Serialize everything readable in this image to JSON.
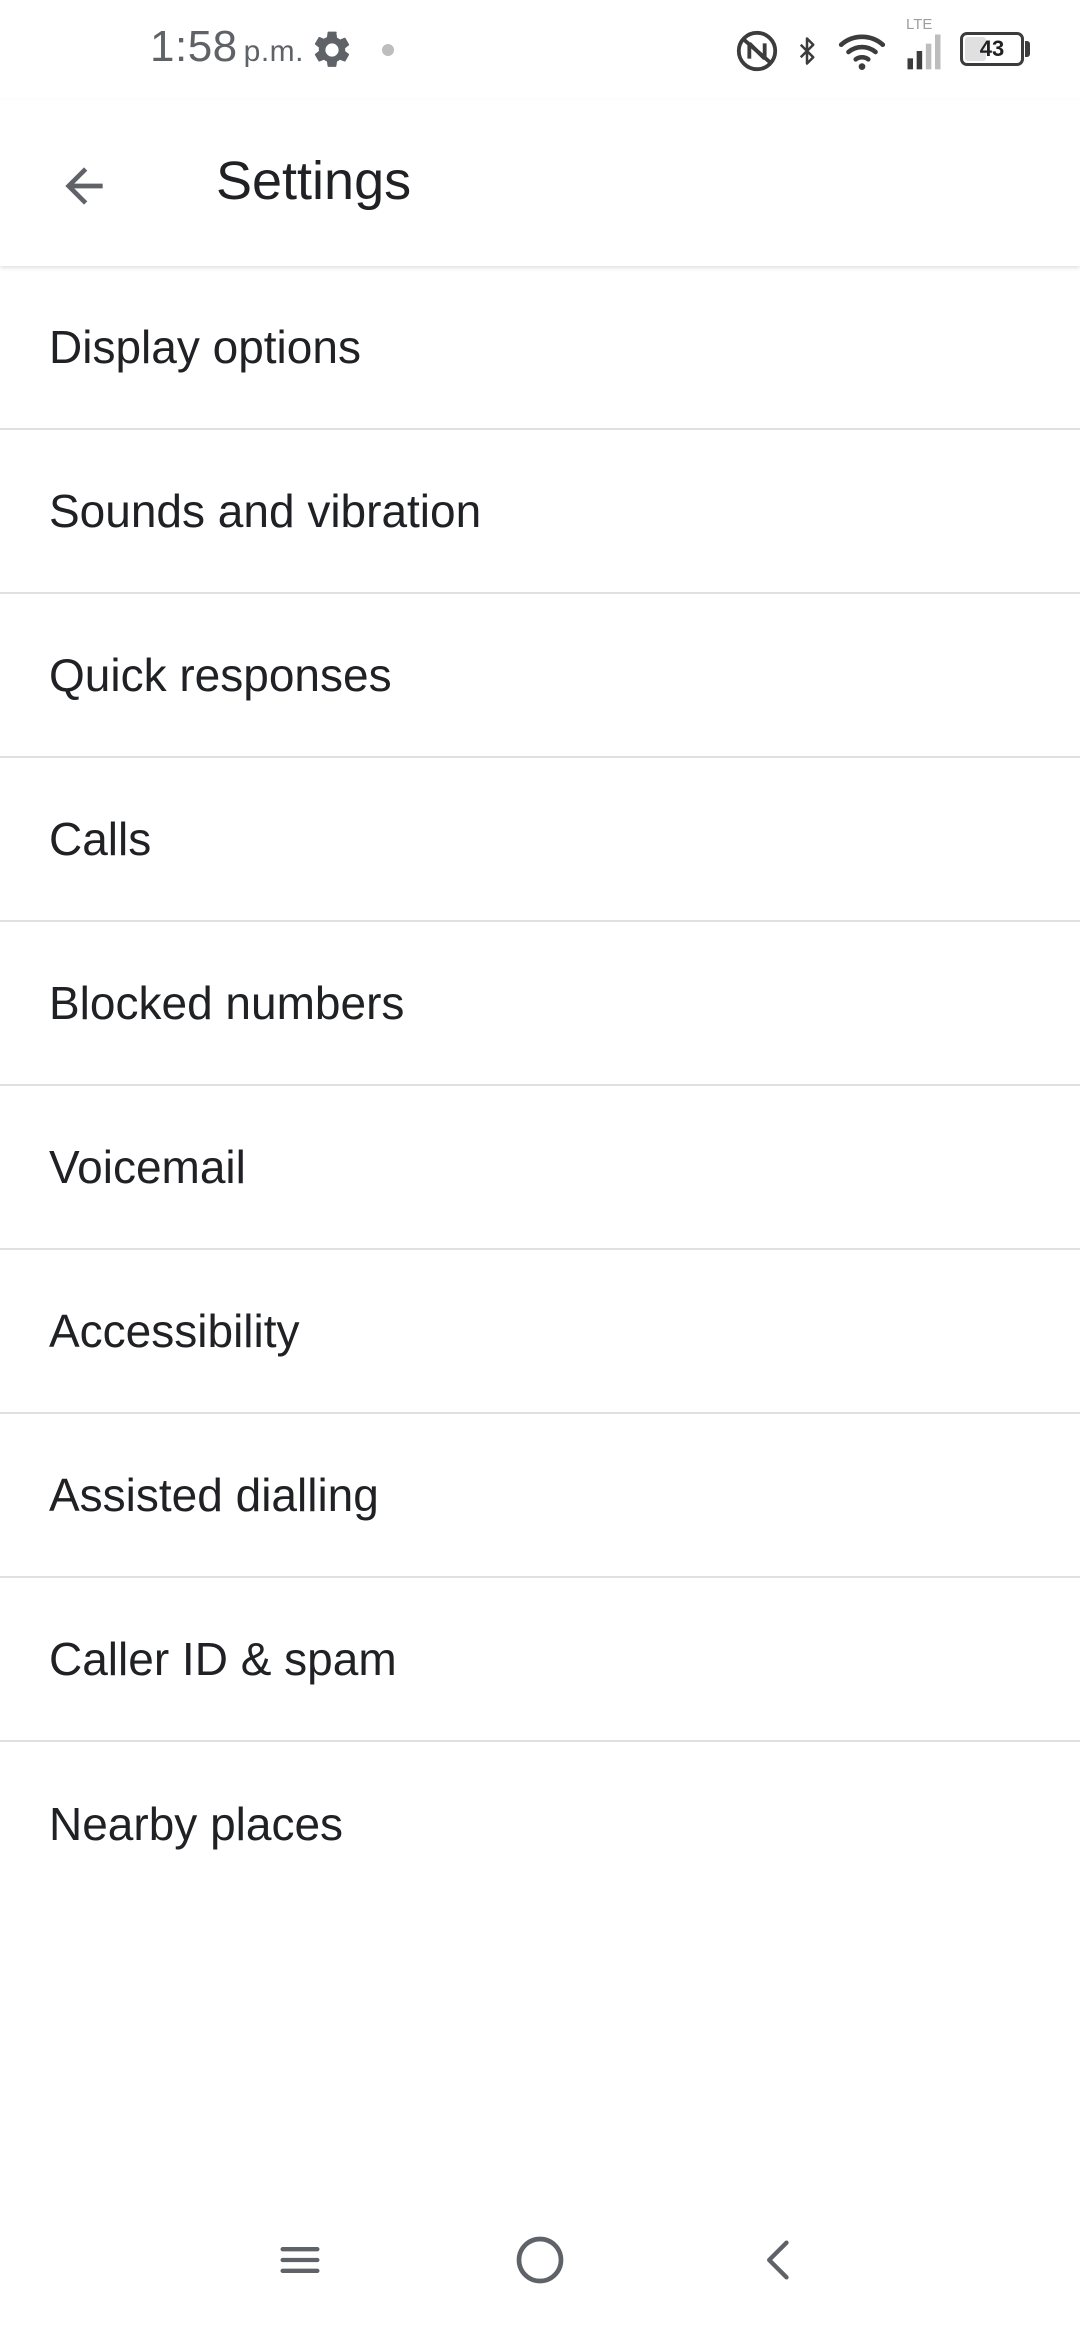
{
  "status_bar": {
    "time": "1:58",
    "ampm": "p.m.",
    "network_label": "LTE",
    "battery_level": "43",
    "battery_fraction": 0.43
  },
  "app_bar": {
    "title": "Settings",
    "back_icon": "arrow-back-icon"
  },
  "settings": {
    "items": [
      {
        "label": "Display options"
      },
      {
        "label": "Sounds and vibration"
      },
      {
        "label": "Quick responses"
      },
      {
        "label": "Calls"
      },
      {
        "label": "Blocked numbers"
      },
      {
        "label": "Voicemail"
      },
      {
        "label": "Accessibility"
      },
      {
        "label": "Assisted dialling"
      },
      {
        "label": "Caller ID & spam"
      },
      {
        "label": "Nearby places"
      }
    ]
  },
  "nav_bar": {
    "recents_icon": "menu-lines-icon",
    "home_icon": "circle-home-icon",
    "back_icon": "chevron-left-icon"
  },
  "colors": {
    "text_primary": "#202124",
    "icon_gray": "#5f6368",
    "divider": "#e0e0e0",
    "background": "#ffffff"
  }
}
